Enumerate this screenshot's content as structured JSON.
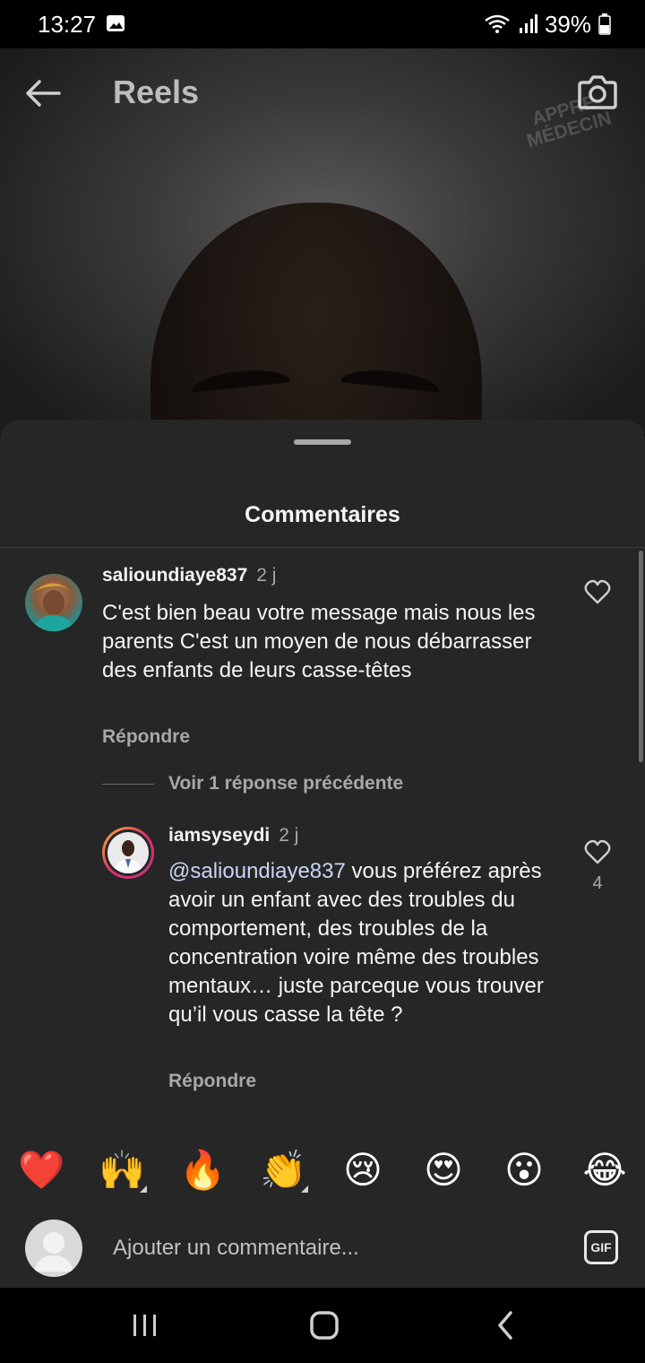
{
  "status_bar": {
    "time": "13:27",
    "battery": "39%"
  },
  "header": {
    "title": "Reels",
    "watermark_line1": "APPRE",
    "watermark_line2": "MÉDECIN"
  },
  "sheet": {
    "title": "Commentaires"
  },
  "comments": [
    {
      "username": "salioundiaye837",
      "time": "2 j",
      "text": "C'est bien beau votre message mais nous les parents C'est un moyen de nous débarrasser des enfants de leurs casse-têtes",
      "reply_label": "Répondre"
    }
  ],
  "view_replies_label": "Voir 1 réponse précédente",
  "reply": {
    "username": "iamsyseydi",
    "time": "2 j",
    "mention": "@salioundiaye837",
    "text": " vous préférez après avoir un enfant avec des troubles du comportement, des troubles de la concentration voire même des troubles mentaux… juste parceque vous trouver qu’il vous casse la tête ?",
    "reply_label": "Répondre",
    "likes": "4"
  },
  "emoji_bar": {
    "items": [
      "❤️",
      "🙌",
      "🔥",
      "👏",
      "😢",
      "😍",
      "😮",
      "😂"
    ]
  },
  "composer": {
    "placeholder": "Ajouter un commentaire...",
    "gif_label": "GIF"
  },
  "colors": {
    "sheet_bg": "#262626",
    "secondary_text": "#a8a8a8",
    "mention": "#c7d6f5"
  }
}
